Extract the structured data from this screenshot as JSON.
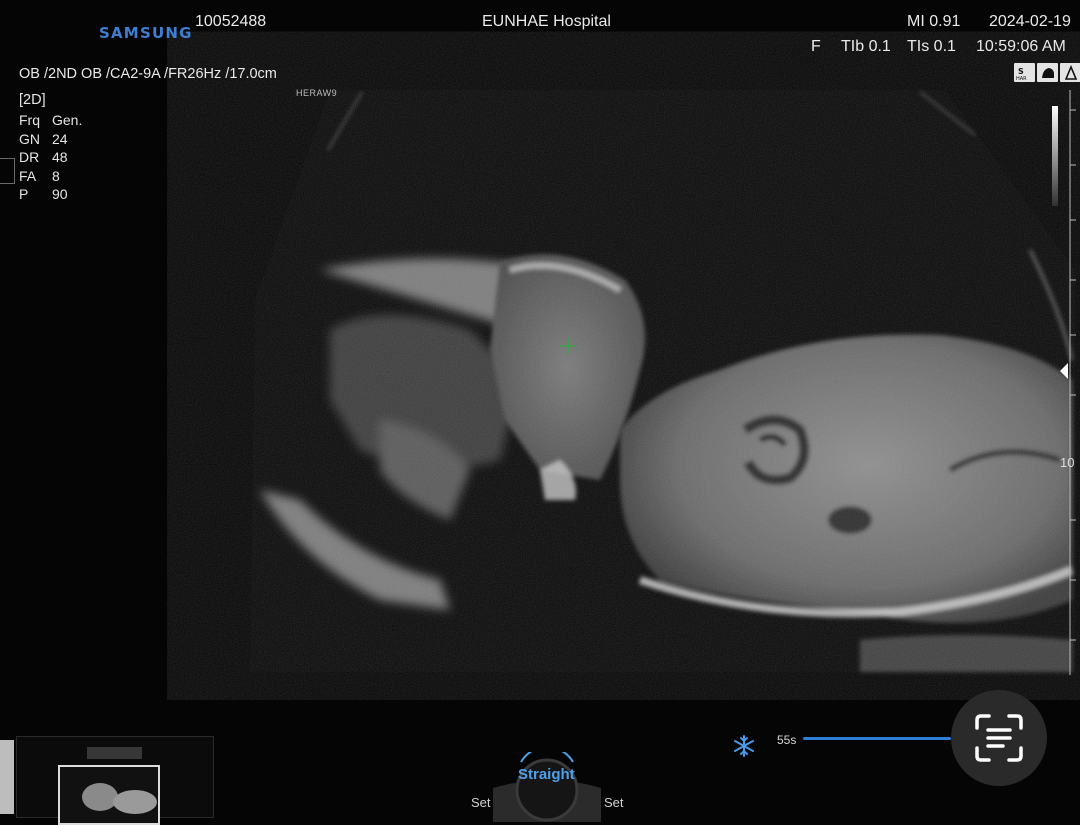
{
  "header": {
    "brand": "SAMSUNG",
    "patient_id": "10052488",
    "hospital": "EUNHAE Hospital",
    "mi": "MI 0.91",
    "date": "2024-02-19",
    "focus": "F",
    "tib": "TIb 0.1",
    "tis": "TIs 0.1",
    "time": "10:59:06 AM"
  },
  "exam_line": "OB /2ND OB /CA2-9A /FR26Hz /17.0cm",
  "mode": "[2D]",
  "params": [
    {
      "k": "Frq",
      "v": "Gen."
    },
    {
      "k": "GN",
      "v": "24"
    },
    {
      "k": "DR",
      "v": "48"
    },
    {
      "k": "FA",
      "v": "8"
    },
    {
      "k": "P",
      "v": "90"
    }
  ],
  "probe_label": "HERAW9",
  "depth_marker": "10",
  "icons": [
    "sharp-icon",
    "fetal-profile-icon",
    "probe-orientation-icon"
  ],
  "bottom": {
    "straight_label": "Straight",
    "set_left": "Set",
    "set_right": "Set",
    "cine_time": "55s"
  },
  "colors": {
    "brand": "#3f7fd1",
    "accent": "#4fa0ea",
    "cine_bar": "#2f7fd8",
    "marker": "#3ca24a"
  }
}
